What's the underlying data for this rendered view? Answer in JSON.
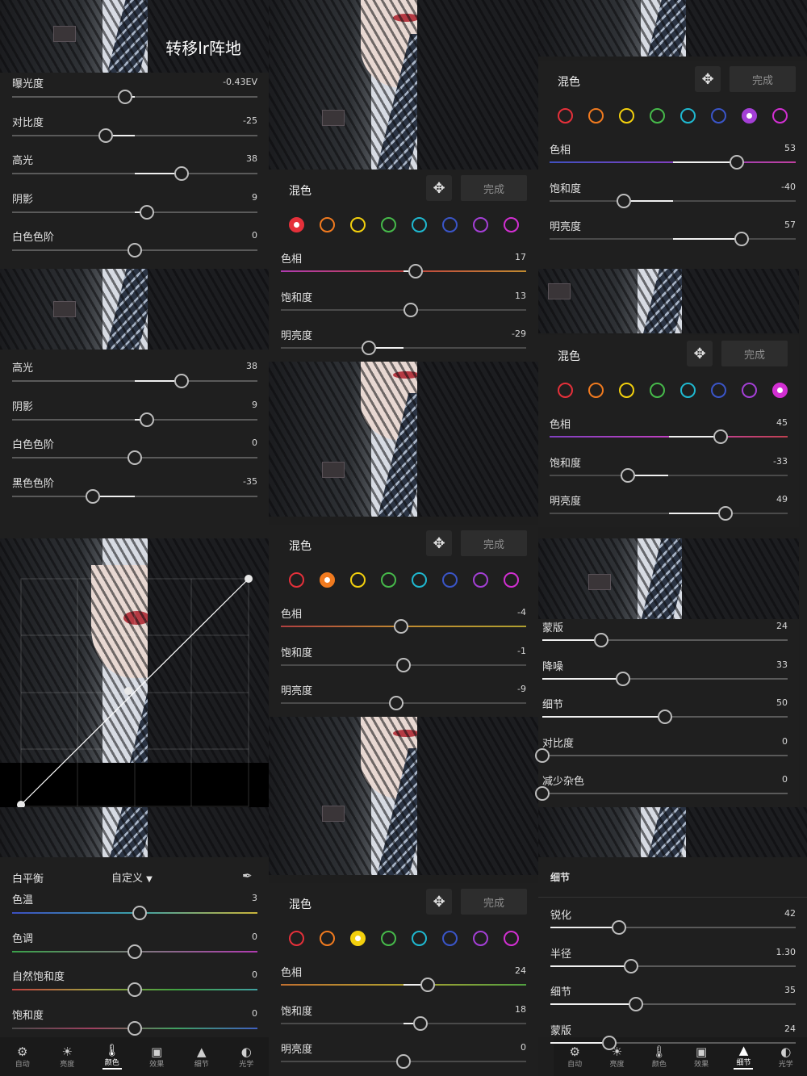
{
  "overlay_text": "转移lr阵地",
  "light_panel": {
    "rows": [
      {
        "label": "曝光度",
        "value": "-0.43EV",
        "level": 0.46
      },
      {
        "label": "对比度",
        "value": "-25",
        "level": 0.38
      },
      {
        "label": "高光",
        "value": "38",
        "level": 0.69
      },
      {
        "label": "阴影",
        "value": "9",
        "level": 0.55
      },
      {
        "label": "白色色阶",
        "value": "0",
        "level": 0.5
      }
    ]
  },
  "light_panel_2": {
    "rows": [
      {
        "label": "高光",
        "value": "38",
        "level": 0.69
      },
      {
        "label": "阴影",
        "value": "9",
        "level": 0.55
      },
      {
        "label": "白色色阶",
        "value": "0",
        "level": 0.5
      },
      {
        "label": "黑色色阶",
        "value": "-35",
        "level": 0.33
      }
    ]
  },
  "mix_common": {
    "title": "混色",
    "done": "完成",
    "hue": "色相",
    "sat": "饱和度",
    "lum": "明亮度"
  },
  "mix_panels": [
    {
      "id": "mix-red",
      "selected": 0,
      "hue": "17",
      "sat": "13",
      "lum": "-29",
      "levels": [
        0.55,
        0.53,
        0.36
      ]
    },
    {
      "id": "mix-orange",
      "selected": 1,
      "hue": "-4",
      "sat": "-1",
      "lum": "-9",
      "levels": [
        0.49,
        0.5,
        0.47
      ]
    },
    {
      "id": "mix-yellow",
      "selected": 2,
      "hue": "24",
      "sat": "18",
      "lum": "0",
      "levels": [
        0.6,
        0.57,
        0.5
      ]
    },
    {
      "id": "mix-purple",
      "selected": 6,
      "hue": "53",
      "sat": "-40",
      "lum": "57",
      "levels": [
        0.76,
        0.3,
        0.78
      ]
    },
    {
      "id": "mix-magenta",
      "selected": 7,
      "hue": "45",
      "sat": "-33",
      "lum": "49",
      "levels": [
        0.72,
        0.33,
        0.74
      ]
    }
  ],
  "mix_colors": [
    "#e5303a",
    "#f07a1f",
    "#f3d00d",
    "#46b94a",
    "#1fb8d0",
    "#3a55c8",
    "#a43fd6",
    "#d22fd2"
  ],
  "color_panel": {
    "wb_label": "白平衡",
    "wb_value": "自定义",
    "rows": [
      {
        "label": "色温",
        "value": "3",
        "level": 0.52
      },
      {
        "label": "色调",
        "value": "0",
        "level": 0.5
      },
      {
        "label": "自然饱和度",
        "value": "0",
        "level": 0.5
      },
      {
        "label": "饱和度",
        "value": "0",
        "level": 0.5
      }
    ]
  },
  "detail_panel_1": {
    "rows": [
      {
        "label": "蒙版",
        "value": "24",
        "level": 0.24
      },
      {
        "label": "降噪",
        "value": "33",
        "level": 0.33
      },
      {
        "label": "细节",
        "value": "50",
        "level": 0.5
      },
      {
        "label": "对比度",
        "value": "0",
        "level": 0.0
      },
      {
        "label": "减少杂色",
        "value": "0",
        "level": 0.0
      }
    ]
  },
  "detail_panel_2": {
    "title": "细节",
    "rows": [
      {
        "label": "锐化",
        "value": "42",
        "level": 0.28
      },
      {
        "label": "半径",
        "value": "1.30",
        "level": 0.33
      },
      {
        "label": "细节",
        "value": "35",
        "level": 0.35
      },
      {
        "label": "蒙版",
        "value": "24",
        "level": 0.24
      }
    ]
  },
  "toolbar_left": {
    "items": [
      {
        "label": "自动",
        "icon": "auto-icon",
        "glyph": "⚙",
        "active": false
      },
      {
        "label": "亮度",
        "icon": "sun-icon",
        "glyph": "☀",
        "active": false
      },
      {
        "label": "颜色",
        "icon": "thermometer-icon",
        "glyph": "🌡",
        "active": true
      },
      {
        "label": "效果",
        "icon": "effects-icon",
        "glyph": "▣",
        "active": false
      },
      {
        "label": "细节",
        "icon": "detail-icon",
        "glyph": "▲",
        "active": false
      },
      {
        "label": "光学",
        "icon": "optics-icon",
        "glyph": "◐",
        "active": false
      }
    ]
  },
  "toolbar_right": {
    "items": [
      {
        "label": "自动",
        "icon": "auto-icon",
        "glyph": "⚙",
        "active": false
      },
      {
        "label": "亮度",
        "icon": "sun-icon",
        "glyph": "☀",
        "active": false
      },
      {
        "label": "颜色",
        "icon": "thermometer-icon",
        "glyph": "🌡",
        "active": false
      },
      {
        "label": "效果",
        "icon": "effects-icon",
        "glyph": "▣",
        "active": false
      },
      {
        "label": "细节",
        "icon": "detail-icon",
        "glyph": "▲",
        "active": true
      },
      {
        "label": "光学",
        "icon": "optics-icon",
        "glyph": "◐",
        "active": false
      }
    ]
  }
}
